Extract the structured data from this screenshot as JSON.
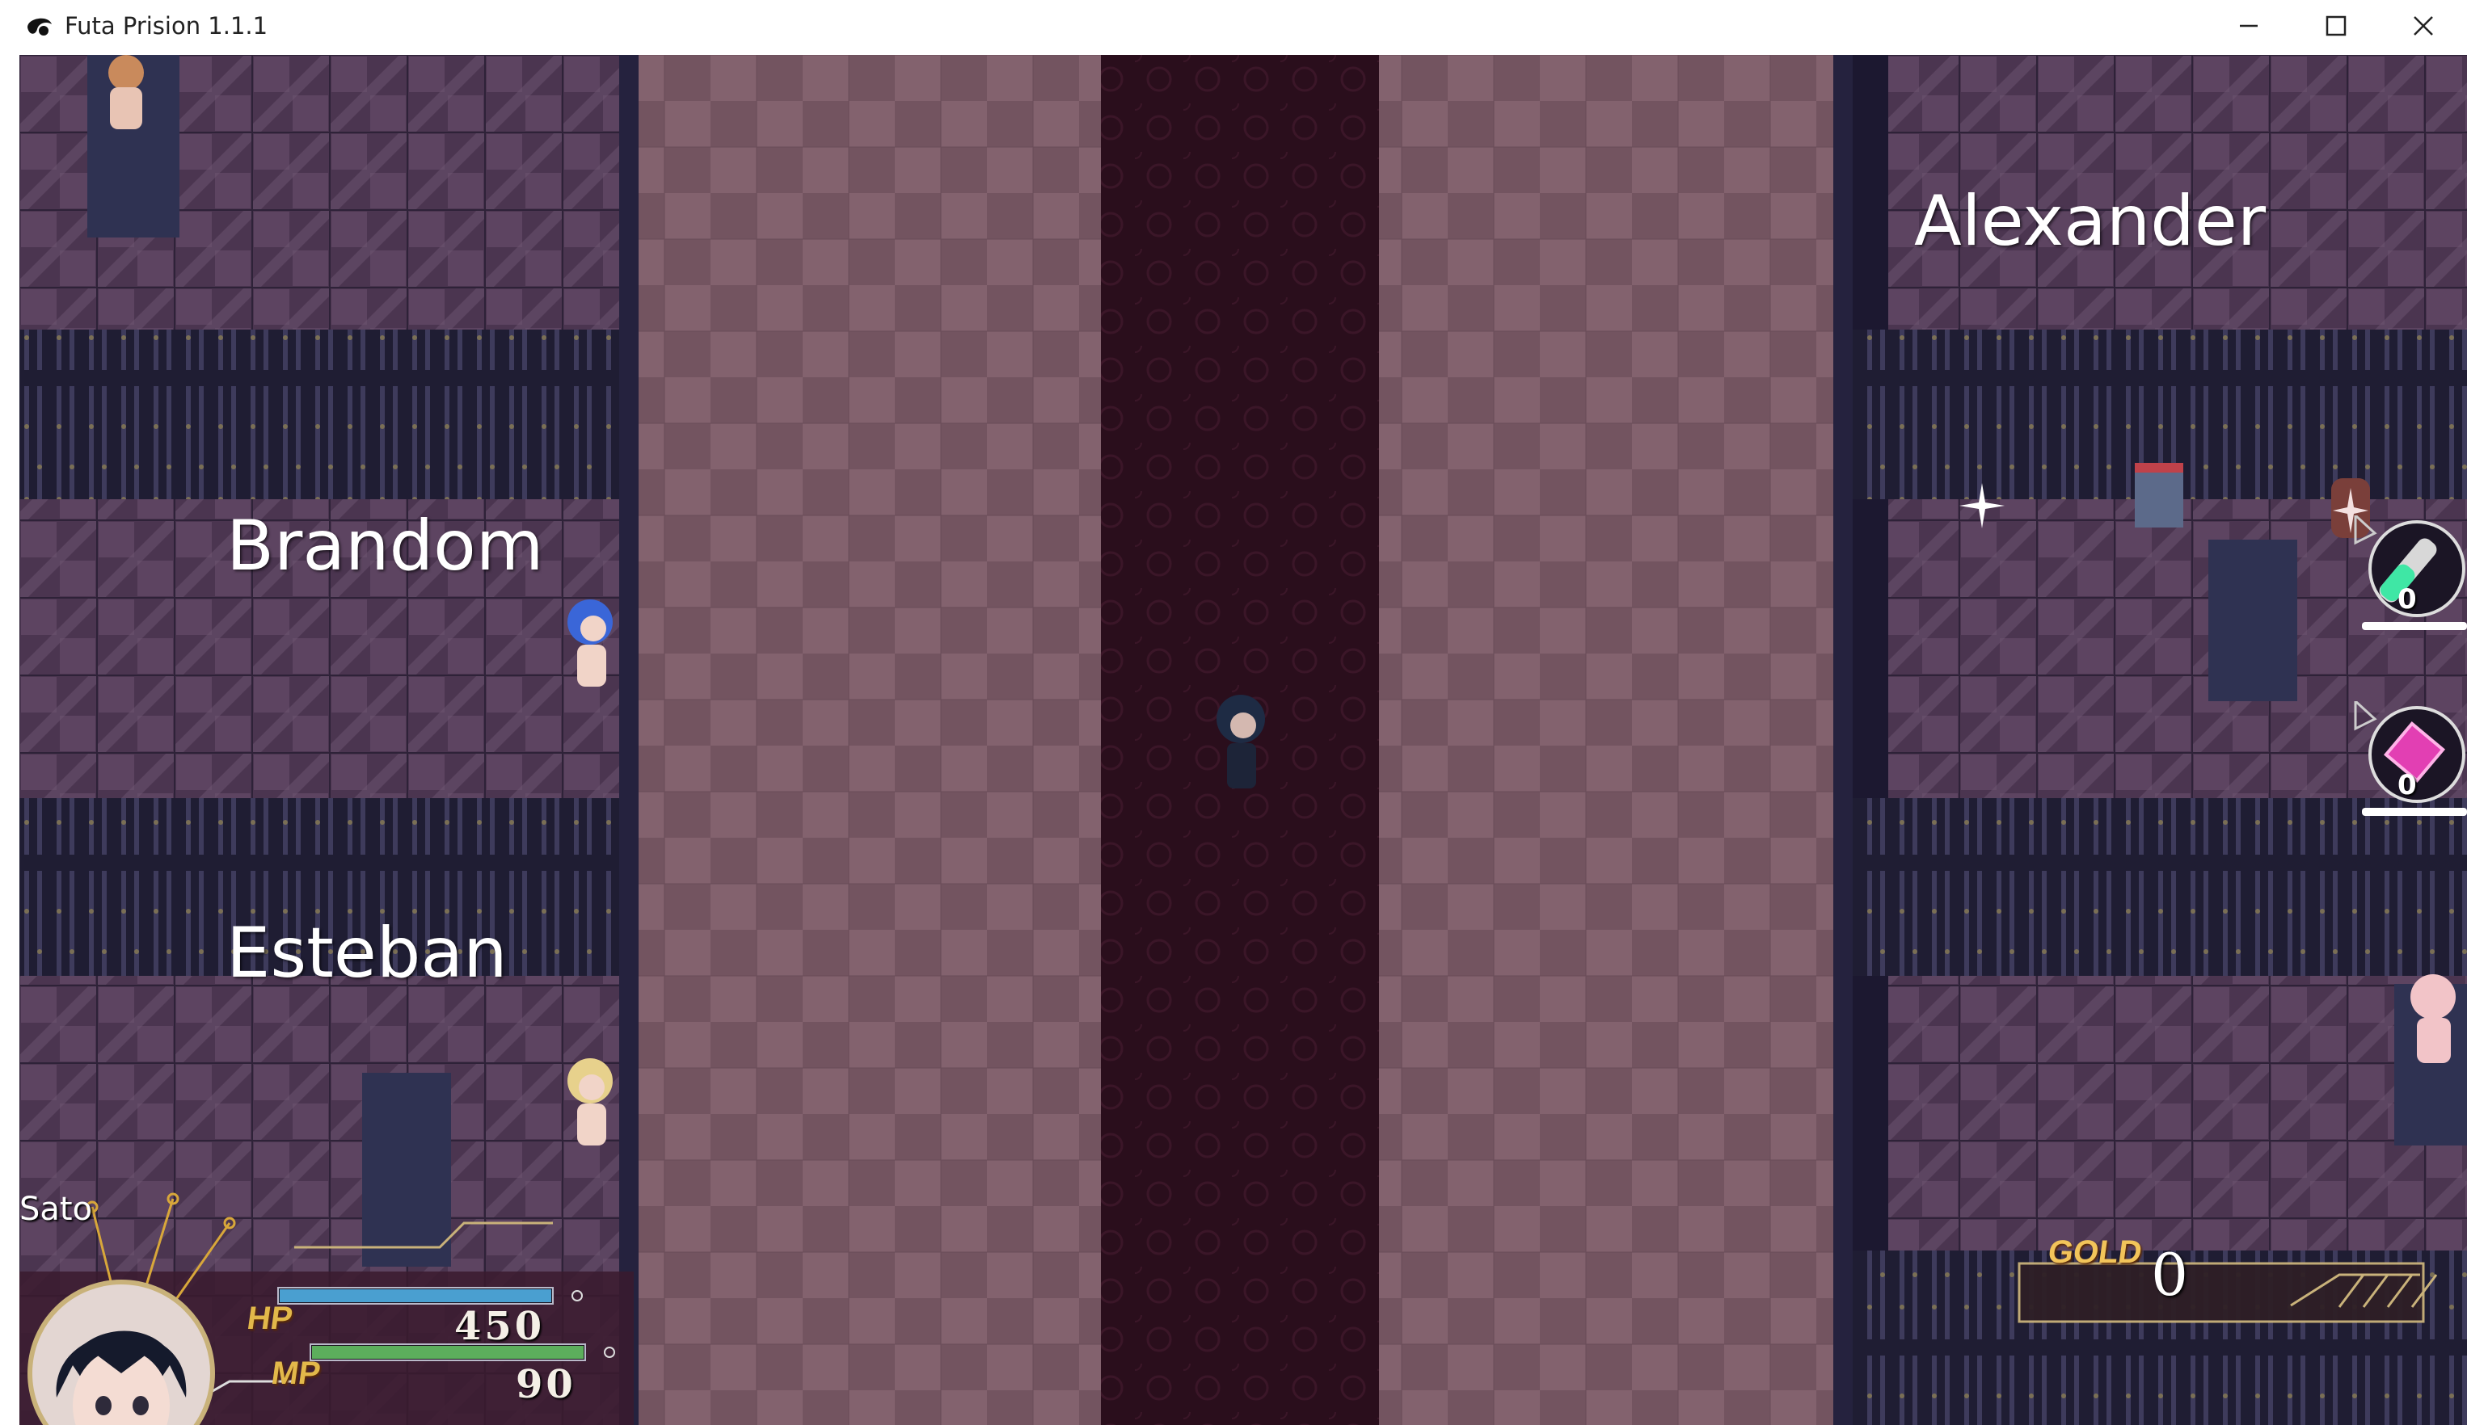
{
  "window": {
    "title": "Futa Prision 1.1.1",
    "controls": {
      "minimize": "minimize-icon",
      "maximize": "maximize-icon",
      "close": "close-icon"
    }
  },
  "map": {
    "room_labels": {
      "brandom": "Brandom",
      "esteban": "Esteban",
      "alexander": "Alexander"
    }
  },
  "hud": {
    "character_name": "Sato",
    "hp_label": "HP",
    "hp_value": "450",
    "mp_label": "MP",
    "mp_value": "90",
    "gold_label": "GOLD",
    "gold_value": "0"
  },
  "quick_items": [
    {
      "icon": "potion-vial-icon",
      "count": "0"
    },
    {
      "icon": "pink-crystal-icon",
      "count": "0"
    }
  ],
  "colors": {
    "floor_light": "#8a6874",
    "floor_dark": "#6f4f5b",
    "carpet": "#2b0f1d",
    "cell_floor": "#4a3550",
    "wall": "#1c1830",
    "hp_bar": "#4a9fd0",
    "mp_bar": "#5cae5c",
    "gold_accent": "#d8a73a"
  }
}
